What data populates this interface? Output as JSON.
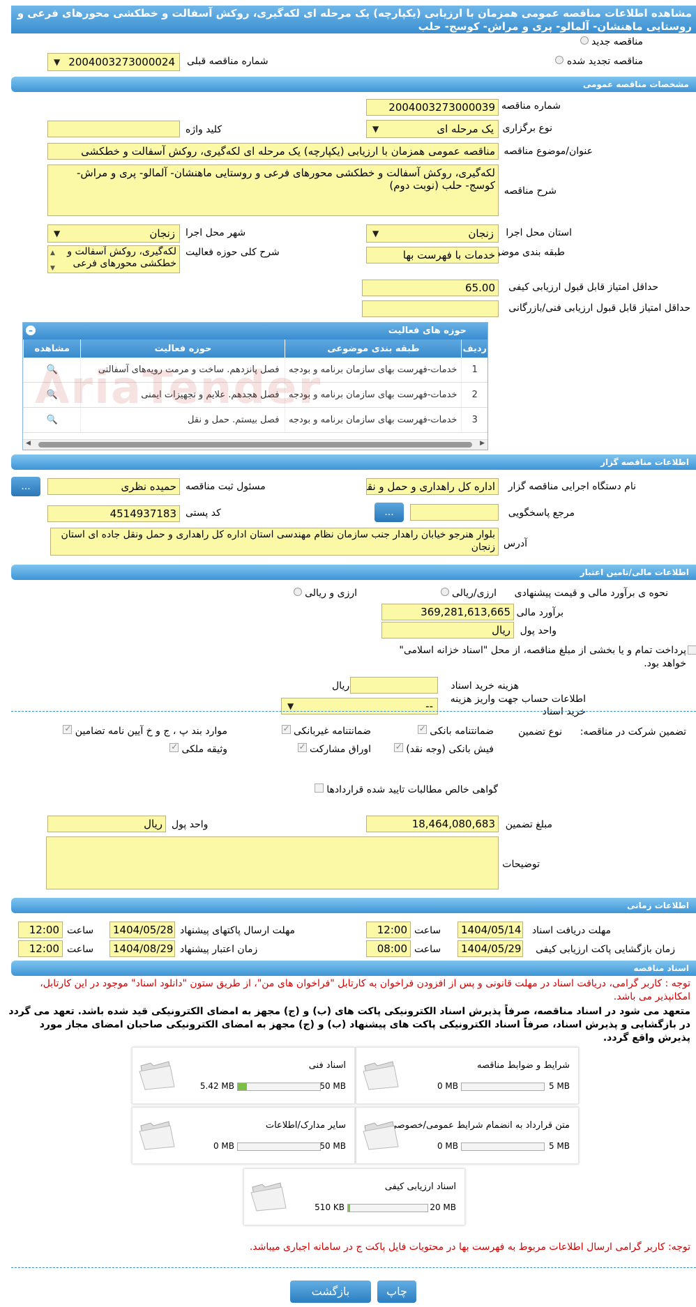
{
  "page": {
    "title": "مشاهده اطلاعات مناقصه عمومی همزمان با ارزیابی (یکپارچه) یک مرحله ای لکه‌گیری، روکش آسفالت و خطکشی محورهای فرعی و روستایی ماهنشان- آلمالو- پری و مراش- کوسج- حلب",
    "watermark": "AriaTender"
  },
  "header_options": {
    "new_tender": "مناقصه جدید",
    "renewed_tender": "مناقصه تجدید شده",
    "previous_number_label": "شماره مناقصه قبلی",
    "previous_number": "2004003273000024"
  },
  "general": {
    "section_title": "مشخصات مناقصه عمومی",
    "number_label": "شماره مناقصه",
    "number": "2004003273000039",
    "type_label": "نوع برگزاری",
    "type": "یک مرحله ای",
    "keyword_label": "کلید واژه",
    "keyword": "",
    "subject_label": "عنوان/موضوع مناقصه",
    "subject": "مناقصه عمومی همزمان با ارزیابی (یکپارچه) یک مرحله ای لکه‌گیری، روکش آسفالت و خطکشی",
    "desc_label": "شرح مناقصه",
    "desc": "لکه‌گیری، روکش آسفالت و خطکشی محورهای فرعی و روستایی ماهنشان- آلمالو- پری و مراش- کوسج- حلب (نوبت دوم)",
    "province_label": "استان محل اجرا",
    "province": "زنجان",
    "city_label": "شهر محل اجرا",
    "city": "زنجان",
    "category_label": "طبقه بندی موضوعی",
    "category": "خدمات با فهرست بها",
    "activity_desc_label": "شرح کلی حوزه فعالیت",
    "activity_desc": "لکه‌گیری، روکش آسفالت و خطکشی محورهای فرعی",
    "min_quality_label": "حداقل امتیاز قابل قبول ارزیابی کیفی",
    "min_quality": "65.00",
    "min_tech_label": "حداقل امتیاز قابل قبول ارزیابی فنی/بازرگانی",
    "min_tech": ""
  },
  "activity_grid": {
    "title": "حوزه های فعالیت",
    "headers": [
      "ردیف",
      "طبقه بندی موضوعی",
      "حوزه فعالیت",
      "مشاهده"
    ],
    "rows": [
      {
        "idx": "1",
        "category": "خدمات-فهرست بهای سازمان برنامه و بودجه",
        "activity": "فصل پانزدهم. ساخت و مرمت رویه‌های آسفالتی"
      },
      {
        "idx": "2",
        "category": "خدمات-فهرست بهای سازمان برنامه و بودجه",
        "activity": "فصل هجدهم. علایم و تجهیزات ایمنی"
      },
      {
        "idx": "3",
        "category": "خدمات-فهرست بهای سازمان برنامه و بودجه",
        "activity": "فصل بیستم. حمل و نقل"
      }
    ]
  },
  "organizer": {
    "section_title": "اطلاعات مناقصه گزار",
    "org_label": "نام دستگاه اجرایی مناقصه گزار",
    "org": "اداره کل راهداری و حمل و نقل",
    "registrar_label": "مسئول ثبت مناقصه",
    "registrar": "حمیده نظری",
    "dots": "...",
    "ref_label": "مرجع پاسخگویی",
    "ref": "",
    "postal_label": "کد پستی",
    "postal": "4514937183",
    "address_label": "آدرس",
    "address": "بلوار هنرجو خیابان راهدار جنب سازمان نظام مهندسی استان اداره کل راهداری و حمل ونقل جاده ای استان زنجان"
  },
  "finance": {
    "section_title": "اطلاعات مالی/تامین اعتبار",
    "method_label": "نحوه ی برآورد مالی و قیمت پیشنهادی",
    "opt1": "ارزی/ریالی",
    "opt2": "ارزی و ریالی",
    "estimate_label": "برآورد مالی",
    "estimate": "369,281,613,665",
    "currency_label": "واحد پول",
    "currency": "ریال",
    "islamic_note": "پرداخت تمام و یا بخشی از مبلغ مناقصه، از محل \"اسناد خزانه اسلامی\" خواهد بود.",
    "doc_cost_label": "هزینه خرید اسناد",
    "doc_cost": "",
    "doc_cost_unit": "ریال",
    "account_label": "اطلاعات حساب جهت واریز هزینه خرید اسناد",
    "account": "--"
  },
  "guarantee": {
    "label": "تضمین شرکت در مناقصه:",
    "type_label": "نوع تضمین",
    "options": {
      "bank_guarantee": "ضمانتنامه بانکی",
      "nonbank_guarantee": "ضمانتنامه غیربانکی",
      "items": "موارد بند پ ، ج و خ آیین نامه تضامین",
      "bank_receipt": "فیش بانکی (وجه نقد)",
      "bonds": "اوراق مشارکت",
      "property": "وثیقه ملکی",
      "receivables": "گواهی خالص مطالبات تایید شده قراردادها"
    },
    "amount_label": "مبلغ تضمین",
    "amount": "18,464,080,683",
    "currency_label": "واحد پول",
    "currency": "ریال",
    "notes_label": "توضیحات",
    "notes": ""
  },
  "schedule": {
    "section_title": "اطلاعات زمانی",
    "doc_receive_label": "مهلت دریافت اسناد",
    "doc_receive_date": "1404/05/14",
    "doc_receive_time": "12:00",
    "submit_label": "مهلت ارسال پاکتهای پیشنهاد",
    "submit_date": "1404/05/28",
    "submit_time": "12:00",
    "open_label": "زمان بازگشایی پاکت ارزیابی کیفی",
    "open_date": "1404/05/29",
    "open_time": "08:00",
    "validity_label": "زمان اعتبار پیشنهاد",
    "validity_date": "1404/08/29",
    "validity_time": "12:00",
    "time_label": "ساعت"
  },
  "documents": {
    "section_title": "اسناد مناقصه",
    "notice": "توجه : کاربر گرامی، دریافت اسناد در مهلت قانونی و پس از افزودن فراخوان به کارتابل \"فراخوان های من\"، از طریق ستون \"دانلود اسناد\" موجود در این کارتابل، امکانپذیر می باشد.",
    "commitment": "متعهد می شود در اسناد مناقصه، صرفاً پذیرش اسناد الکترونیکی پاکت های (ب) و (ج) مجهز به امضای الکترونیکی قید شده باشد. تعهد می گردد در بازگشایی و پذیرش اسناد، صرفاً اسناد الکترونیکی پاکت های پیشنهاد (ب) و (ج) مجهز به امضای الکترونیکی صاحبان امضای مجاز مورد پذیرش واقع گردد.",
    "files": [
      {
        "name": "شرایط و ضوابط مناقصه",
        "used": "0 MB",
        "max": "5 MB",
        "fill": 0
      },
      {
        "name": "اسناد فنی",
        "used": "5.42 MB",
        "max": "50 MB",
        "fill": 0.108
      },
      {
        "name": "متن قرارداد به انضمام شرایط عمومی/خصوصی",
        "used": "0 MB",
        "max": "5 MB",
        "fill": 0
      },
      {
        "name": "سایر مدارک/اطلاعات",
        "used": "0 MB",
        "max": "50 MB",
        "fill": 0
      },
      {
        "name": "اسناد ارزیابی کیفی",
        "used": "510 KB",
        "max": "20 MB",
        "fill": 0.025
      }
    ],
    "footer_notice": "توجه: کاربر گرامی ارسال اطلاعات مربوط به فهرست بها در محتویات فایل پاکت ج در سامانه اجباری میباشد."
  },
  "actions": {
    "back": "بازگشت",
    "print": "چاپ"
  }
}
